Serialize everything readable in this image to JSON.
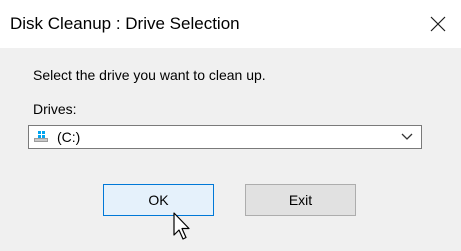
{
  "window": {
    "title": "Disk Cleanup : Drive Selection"
  },
  "titlebar": {
    "close_icon": "close-icon"
  },
  "dialog": {
    "prompt": "Select the drive you want to clean up.",
    "drives_label": "Drives:",
    "selected_drive": "(C:)",
    "drive_icon": "drive-icon"
  },
  "buttons": {
    "ok_label": "OK",
    "exit_label": "Exit"
  },
  "colors": {
    "ok_border": "#0078d7",
    "ok_background": "#e5f1fb",
    "exit_background": "#e1e1e1",
    "dialog_background": "#f0f0f0"
  }
}
